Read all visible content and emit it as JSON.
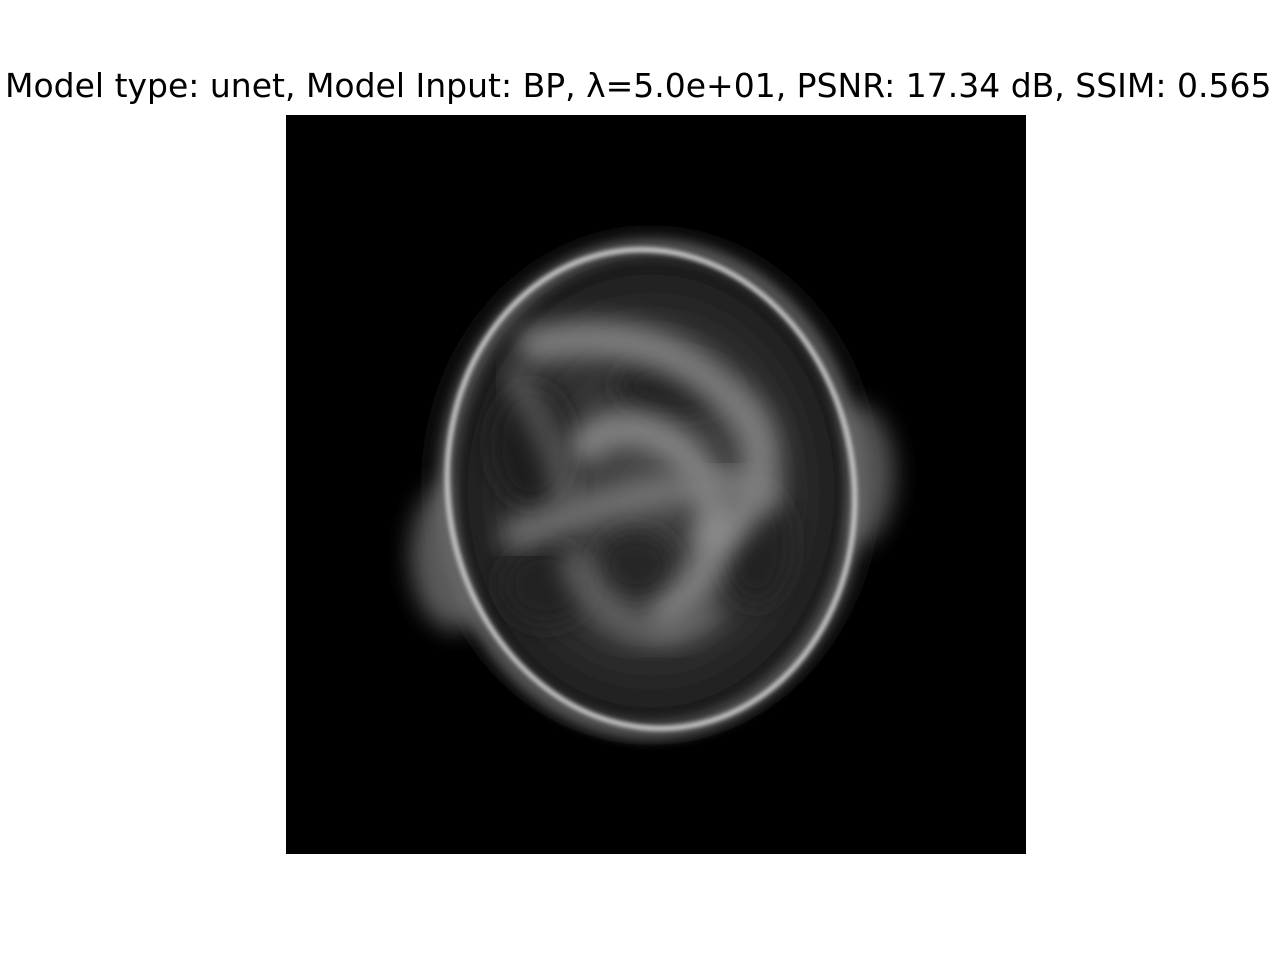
{
  "figure": {
    "title": "Model type: unet, Model Input: BP, λ=5.0e+01, PSNR: 17.34 dB, SSIM: 0.565",
    "background_color": "#ffffff"
  },
  "image": {
    "description_kind": "grayscale reconstruction",
    "colormap": "gray",
    "panel_color": "#000000"
  }
}
